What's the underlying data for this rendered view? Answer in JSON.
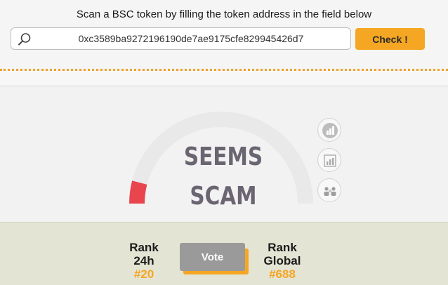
{
  "header": {
    "instruction": "Scan a BSC token by filling the token address in the field below"
  },
  "search": {
    "value": "0xc3589ba9272196190de7ae9175cfe829945426d7",
    "icon": "search-icon",
    "check_label": "Check !",
    "accent_color": "#f5a623"
  },
  "result": {
    "verdict_line1": "SEEMS",
    "verdict_line2": "SCAM",
    "gauge_level": 0.08,
    "gauge_color": "#e8454f",
    "side_icons": [
      "chart-bar-icon",
      "chart-column-icon",
      "users-icon"
    ]
  },
  "ranks": {
    "left": {
      "line1": "Rank",
      "line2": "24h",
      "value": "#20"
    },
    "right": {
      "line1": "Rank",
      "line2": "Global",
      "value": "#688"
    },
    "vote_label": "Vote"
  }
}
